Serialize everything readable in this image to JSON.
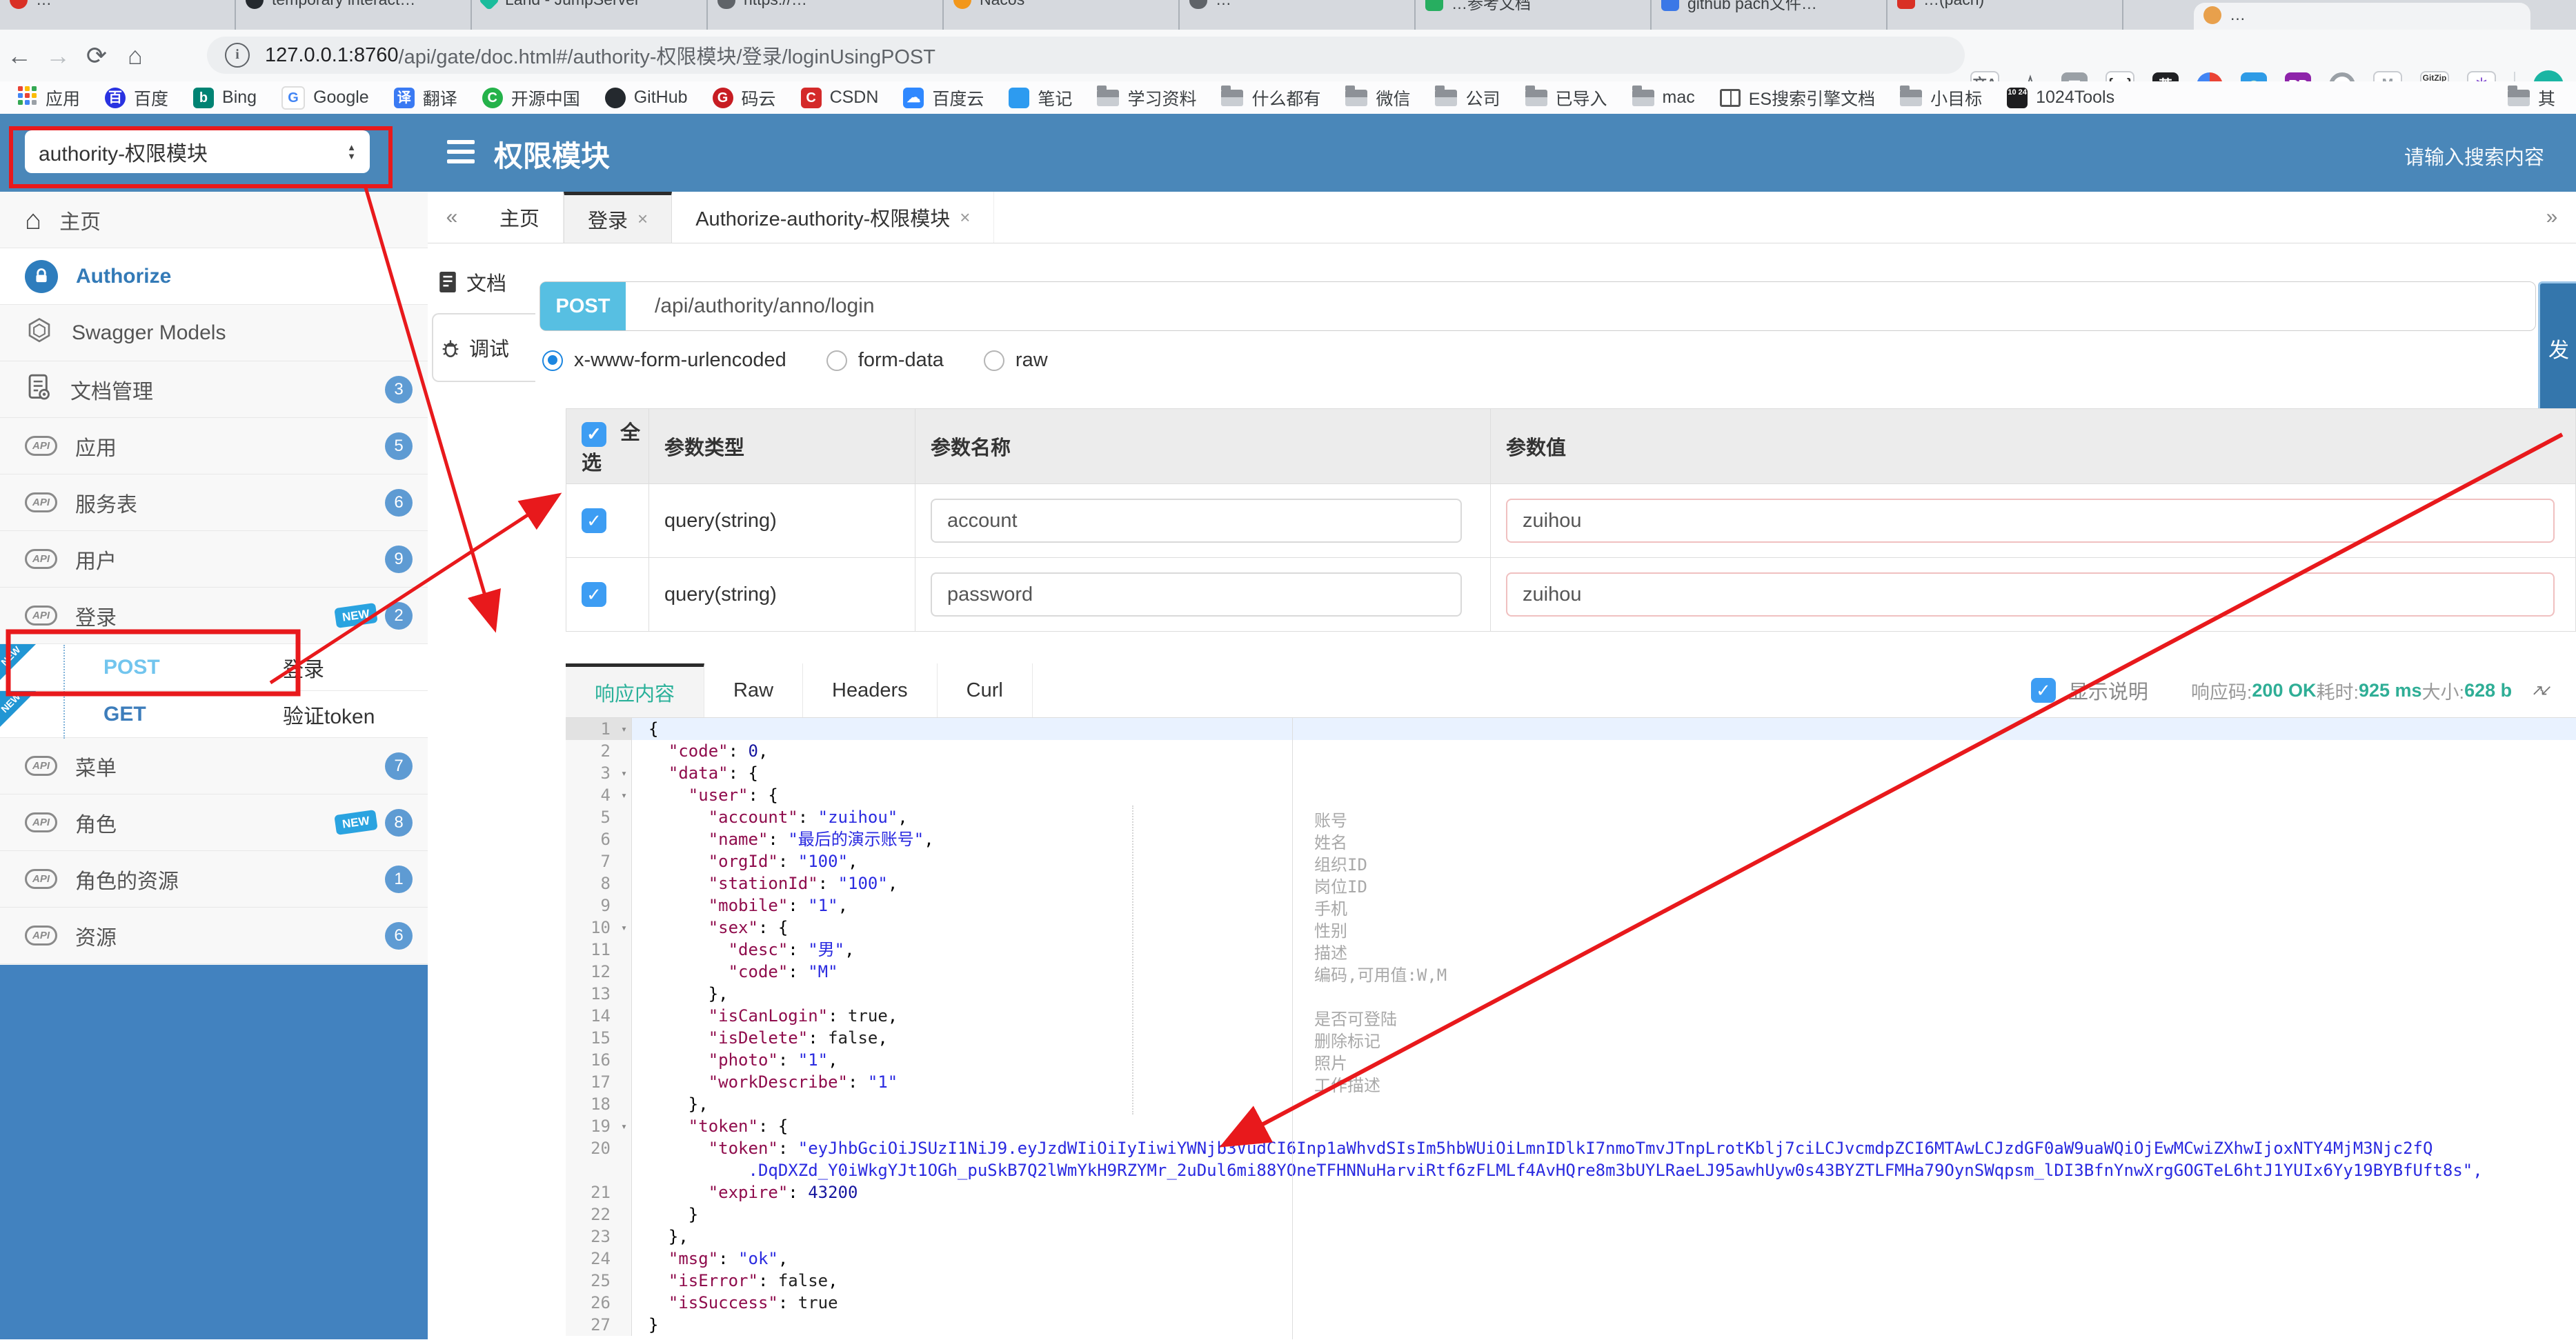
{
  "browser": {
    "tabs": [
      {
        "icon": "red-pin",
        "title": "…"
      },
      {
        "icon": "dark-github",
        "title": "temporary interact…"
      },
      {
        "icon": "teal-gem",
        "title": "Land - JumpServer"
      },
      {
        "icon": "grey-shield",
        "title": "https://…"
      },
      {
        "icon": "orange-nacos",
        "title": "Nacos"
      },
      {
        "icon": "grey-shield",
        "title": "…"
      },
      {
        "icon": "green-square",
        "title": "…参考文档"
      },
      {
        "icon": "blue-square",
        "title": "github pach文件…"
      },
      {
        "icon": "red-square",
        "title": "…(pach)"
      }
    ],
    "active_tab": {
      "icon": "orange-dot",
      "title": "…"
    },
    "nav": {
      "url_host": "127.0.0.1:8760",
      "url_path": "/api/gate/doc.html#/authority-权限模块/登录/loginUsingPOST",
      "info": "i"
    },
    "extensions": [
      "translate",
      "star",
      "notes",
      "braces",
      "en",
      "chrome",
      "globe",
      "rp",
      "oring",
      "mchev",
      "gitzip",
      "asterisk"
    ],
    "bookmarks": [
      {
        "icon": "apps",
        "label": "应用"
      },
      {
        "icon": "baidu",
        "label": "百度"
      },
      {
        "icon": "bing",
        "label": "Bing"
      },
      {
        "icon": "google",
        "label": "Google"
      },
      {
        "icon": "translate",
        "label": "翻译"
      },
      {
        "icon": "osc",
        "label": "开源中国"
      },
      {
        "icon": "github",
        "label": "GitHub"
      },
      {
        "icon": "gitee",
        "label": "码云"
      },
      {
        "icon": "csdn",
        "label": "CSDN"
      },
      {
        "icon": "baiduyun",
        "label": "百度云"
      },
      {
        "icon": "note",
        "label": "笔记"
      },
      {
        "icon": "folder",
        "label": "学习资料"
      },
      {
        "icon": "folder",
        "label": "什么都有"
      },
      {
        "icon": "folder",
        "label": "微信"
      },
      {
        "icon": "folder",
        "label": "公司"
      },
      {
        "icon": "folder",
        "label": "已导入"
      },
      {
        "icon": "folder",
        "label": "mac"
      },
      {
        "icon": "book",
        "label": "ES搜索引擎文档"
      },
      {
        "icon": "folder",
        "label": "小目标"
      },
      {
        "icon": "tools1024",
        "label": "1024Tools"
      }
    ],
    "other_bookmarks": "其"
  },
  "header": {
    "module_select": "authority-权限模块",
    "title": "权限模块",
    "search_placeholder": "请输入搜索内容"
  },
  "sidebar": {
    "items": [
      {
        "icon": "home",
        "label": "主页"
      },
      {
        "icon": "lock",
        "label": "Authorize",
        "active": true
      },
      {
        "icon": "hexagon",
        "label": "Swagger Models"
      },
      {
        "icon": "doc-gear",
        "label": "文档管理",
        "badge": "3"
      },
      {
        "icon": "api",
        "label": "应用",
        "badge": "5"
      },
      {
        "icon": "api",
        "label": "服务表",
        "badge": "6"
      },
      {
        "icon": "api",
        "label": "用户",
        "badge": "9"
      },
      {
        "icon": "api",
        "label": "登录",
        "badge": "2",
        "new": true
      },
      {
        "sub": true,
        "method": "POST",
        "label": "登录"
      },
      {
        "sub": true,
        "method": "GET",
        "label": "验证token"
      },
      {
        "icon": "api",
        "label": "菜单",
        "badge": "7"
      },
      {
        "icon": "api",
        "label": "角色",
        "badge": "8",
        "new": true
      },
      {
        "icon": "api",
        "label": "角色的资源",
        "badge": "1"
      },
      {
        "icon": "api",
        "label": "资源",
        "badge": "6"
      }
    ]
  },
  "content": {
    "collapse_icon": "«",
    "expand_icon": "»",
    "tabs": [
      {
        "label": "主页"
      },
      {
        "label": "登录",
        "closable": true,
        "active": true
      },
      {
        "label": "Authorize-authority-权限模块",
        "closable": true
      }
    ],
    "side_tabs": [
      {
        "icon": "doc",
        "label": "文档"
      },
      {
        "icon": "bug",
        "label": "调试",
        "active": true
      }
    ],
    "request": {
      "method": "POST",
      "url": "/api/authority/anno/login",
      "send_label": "发"
    },
    "body_types": [
      {
        "label": "x-www-form-urlencoded",
        "selected": true
      },
      {
        "label": "form-data"
      },
      {
        "label": "raw"
      }
    ],
    "params": {
      "headers": [
        "全选",
        "参数类型",
        "参数名称",
        "参数值"
      ],
      "rows": [
        {
          "checked": true,
          "type": "query(string)",
          "name": "account",
          "value": "zuihou"
        },
        {
          "checked": true,
          "type": "query(string)",
          "name": "password",
          "value": "zuihou"
        }
      ]
    },
    "response": {
      "tabs": [
        {
          "label": "响应内容",
          "active": true
        },
        {
          "label": "Raw"
        },
        {
          "label": "Headers"
        },
        {
          "label": "Curl"
        }
      ],
      "show_desc_label": "显示说明",
      "meta": [
        {
          "label": "响应码:",
          "value": "200 OK"
        },
        {
          "label": "耗时:",
          "value": "925 ms"
        },
        {
          "label": "大小:",
          "value": "628 b"
        }
      ]
    }
  },
  "code": {
    "lines": [
      {
        "n": 1,
        "fold": true,
        "hl": true,
        "t": "{"
      },
      {
        "n": 2,
        "t": "  \"code\": 0,"
      },
      {
        "n": 3,
        "fold": true,
        "t": "  \"data\": {"
      },
      {
        "n": 4,
        "fold": true,
        "t": "    \"user\": {"
      },
      {
        "n": 5,
        "t": "      \"account\": \"zuihou\","
      },
      {
        "n": 6,
        "t": "      \"name\": \"最后的演示账号\","
      },
      {
        "n": 7,
        "t": "      \"orgId\": \"100\","
      },
      {
        "n": 8,
        "t": "      \"stationId\": \"100\","
      },
      {
        "n": 9,
        "t": "      \"mobile\": \"1\","
      },
      {
        "n": 10,
        "fold": true,
        "t": "      \"sex\": {"
      },
      {
        "n": 11,
        "t": "        \"desc\": \"男\","
      },
      {
        "n": 12,
        "t": "        \"code\": \"M\""
      },
      {
        "n": 13,
        "t": "      },"
      },
      {
        "n": 14,
        "t": "      \"isCanLogin\": true,"
      },
      {
        "n": 15,
        "t": "      \"isDelete\": false,"
      },
      {
        "n": 16,
        "t": "      \"photo\": \"1\","
      },
      {
        "n": 17,
        "t": "      \"workDescribe\": \"1\""
      },
      {
        "n": 18,
        "t": "    },"
      },
      {
        "n": 19,
        "fold": true,
        "t": "    \"token\": {"
      },
      {
        "n": 20,
        "t": "      \"token\": \"eyJhbGciOiJSUzI1NiJ9.eyJzdWIiOiIyIiwiYWNjb3VudCI6Inp1aWhvdSIsIm5hbWUiOiLmnIDlkI7nmoTmvJTnpLrotKblj7ciLCJvcmdpZCI6MTAwLCJzdGF0aW9uaWQiOjEwMCwiZXhwIjoxNTY4MjM3Njc2fQ",
        "wrap": "          .DqDXZd_Y0iWkgYJt1OGh_puSkB7Q2lWmYkH9RZYMr_2uDul6mi88YOneTFHNNuHarviRtf6zFLMLf4AvHQre8m3bUYLRaeLJ95awhUyw0s43BYZTLFMHa79OynSWqpsm_lDI3BfnYnwXrgGOGTeL6htJ1YUIx6Yy19BYBfUft8s\","
      },
      {
        "n": 21,
        "t": "      \"expire\": 43200"
      },
      {
        "n": 22,
        "t": "    }"
      },
      {
        "n": 23,
        "t": "  },"
      },
      {
        "n": 24,
        "t": "  \"msg\": \"ok\","
      },
      {
        "n": 25,
        "t": "  \"isError\": false,"
      },
      {
        "n": 26,
        "t": "  \"isSuccess\": true"
      },
      {
        "n": 27,
        "t": "}"
      }
    ],
    "annotations": [
      {
        "line": 5,
        "text": "账号"
      },
      {
        "line": 6,
        "text": "姓名"
      },
      {
        "line": 7,
        "text": "组织ID"
      },
      {
        "line": 8,
        "text": "岗位ID"
      },
      {
        "line": 9,
        "text": "手机"
      },
      {
        "line": 10,
        "text": "性别"
      },
      {
        "line": 11,
        "text": "描述"
      },
      {
        "line": 12,
        "text": "编码,可用值:W,M"
      },
      {
        "line": 14,
        "text": "是否可登陆"
      },
      {
        "line": 15,
        "text": "删除标记"
      },
      {
        "line": 16,
        "text": "照片"
      },
      {
        "line": 17,
        "text": "工作描述"
      }
    ]
  },
  "colors": {
    "header_blue": "#4a87b9",
    "sidebar_footer_blue": "#4282bf",
    "post_badge": "#57bfe2",
    "send_button": "#3476ac",
    "success_green": "#2fae96",
    "checkbox_blue": "#3d9df3",
    "badge_blue": "#5e9bd3",
    "annotation_red": "#e8191c"
  }
}
